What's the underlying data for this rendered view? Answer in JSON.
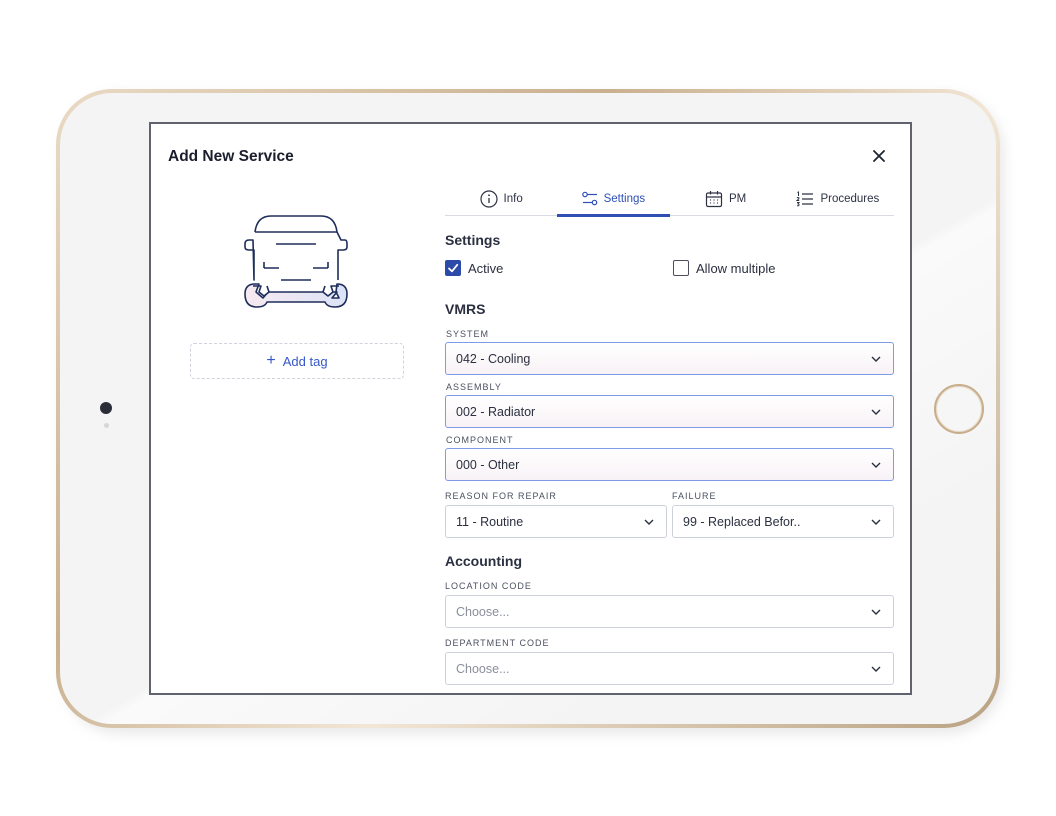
{
  "modal": {
    "title": "Add New Service"
  },
  "tag": {
    "label": "Add tag"
  },
  "tabs": [
    {
      "label": "Info",
      "icon": "info-icon",
      "active": false
    },
    {
      "label": "Settings",
      "icon": "sliders-icon",
      "active": true
    },
    {
      "label": "PM",
      "icon": "calendar-icon",
      "active": false
    },
    {
      "label": "Procedures",
      "icon": "numbered-list-icon",
      "active": false
    }
  ],
  "settings": {
    "title": "Settings",
    "active": {
      "label": "Active",
      "checked": true
    },
    "allow_multiple": {
      "label": "Allow multiple",
      "checked": false
    }
  },
  "vmrs": {
    "title": "VMRS",
    "system": {
      "label": "SYSTEM",
      "value": "042 - Cooling"
    },
    "assembly": {
      "label": "ASSEMBLY",
      "value": "002 - Radiator"
    },
    "component": {
      "label": "COMPONENT",
      "value": "000 - Other"
    },
    "reason": {
      "label": "REASON FOR REPAIR",
      "value": "11 - Routine"
    },
    "failure": {
      "label": "FAILURE",
      "value": "99 - Replaced Befor.."
    }
  },
  "accounting": {
    "title": "Accounting",
    "location": {
      "label": "LOCATION CODE",
      "placeholder": "Choose..."
    },
    "department": {
      "label": "DEPARTMENT CODE",
      "placeholder": "Choose..."
    }
  },
  "colors": {
    "accent": "#2f4fb5",
    "checkbox": "#2d4aa8",
    "link": "#3557c9",
    "highlight_border": "#7f9ae6"
  }
}
